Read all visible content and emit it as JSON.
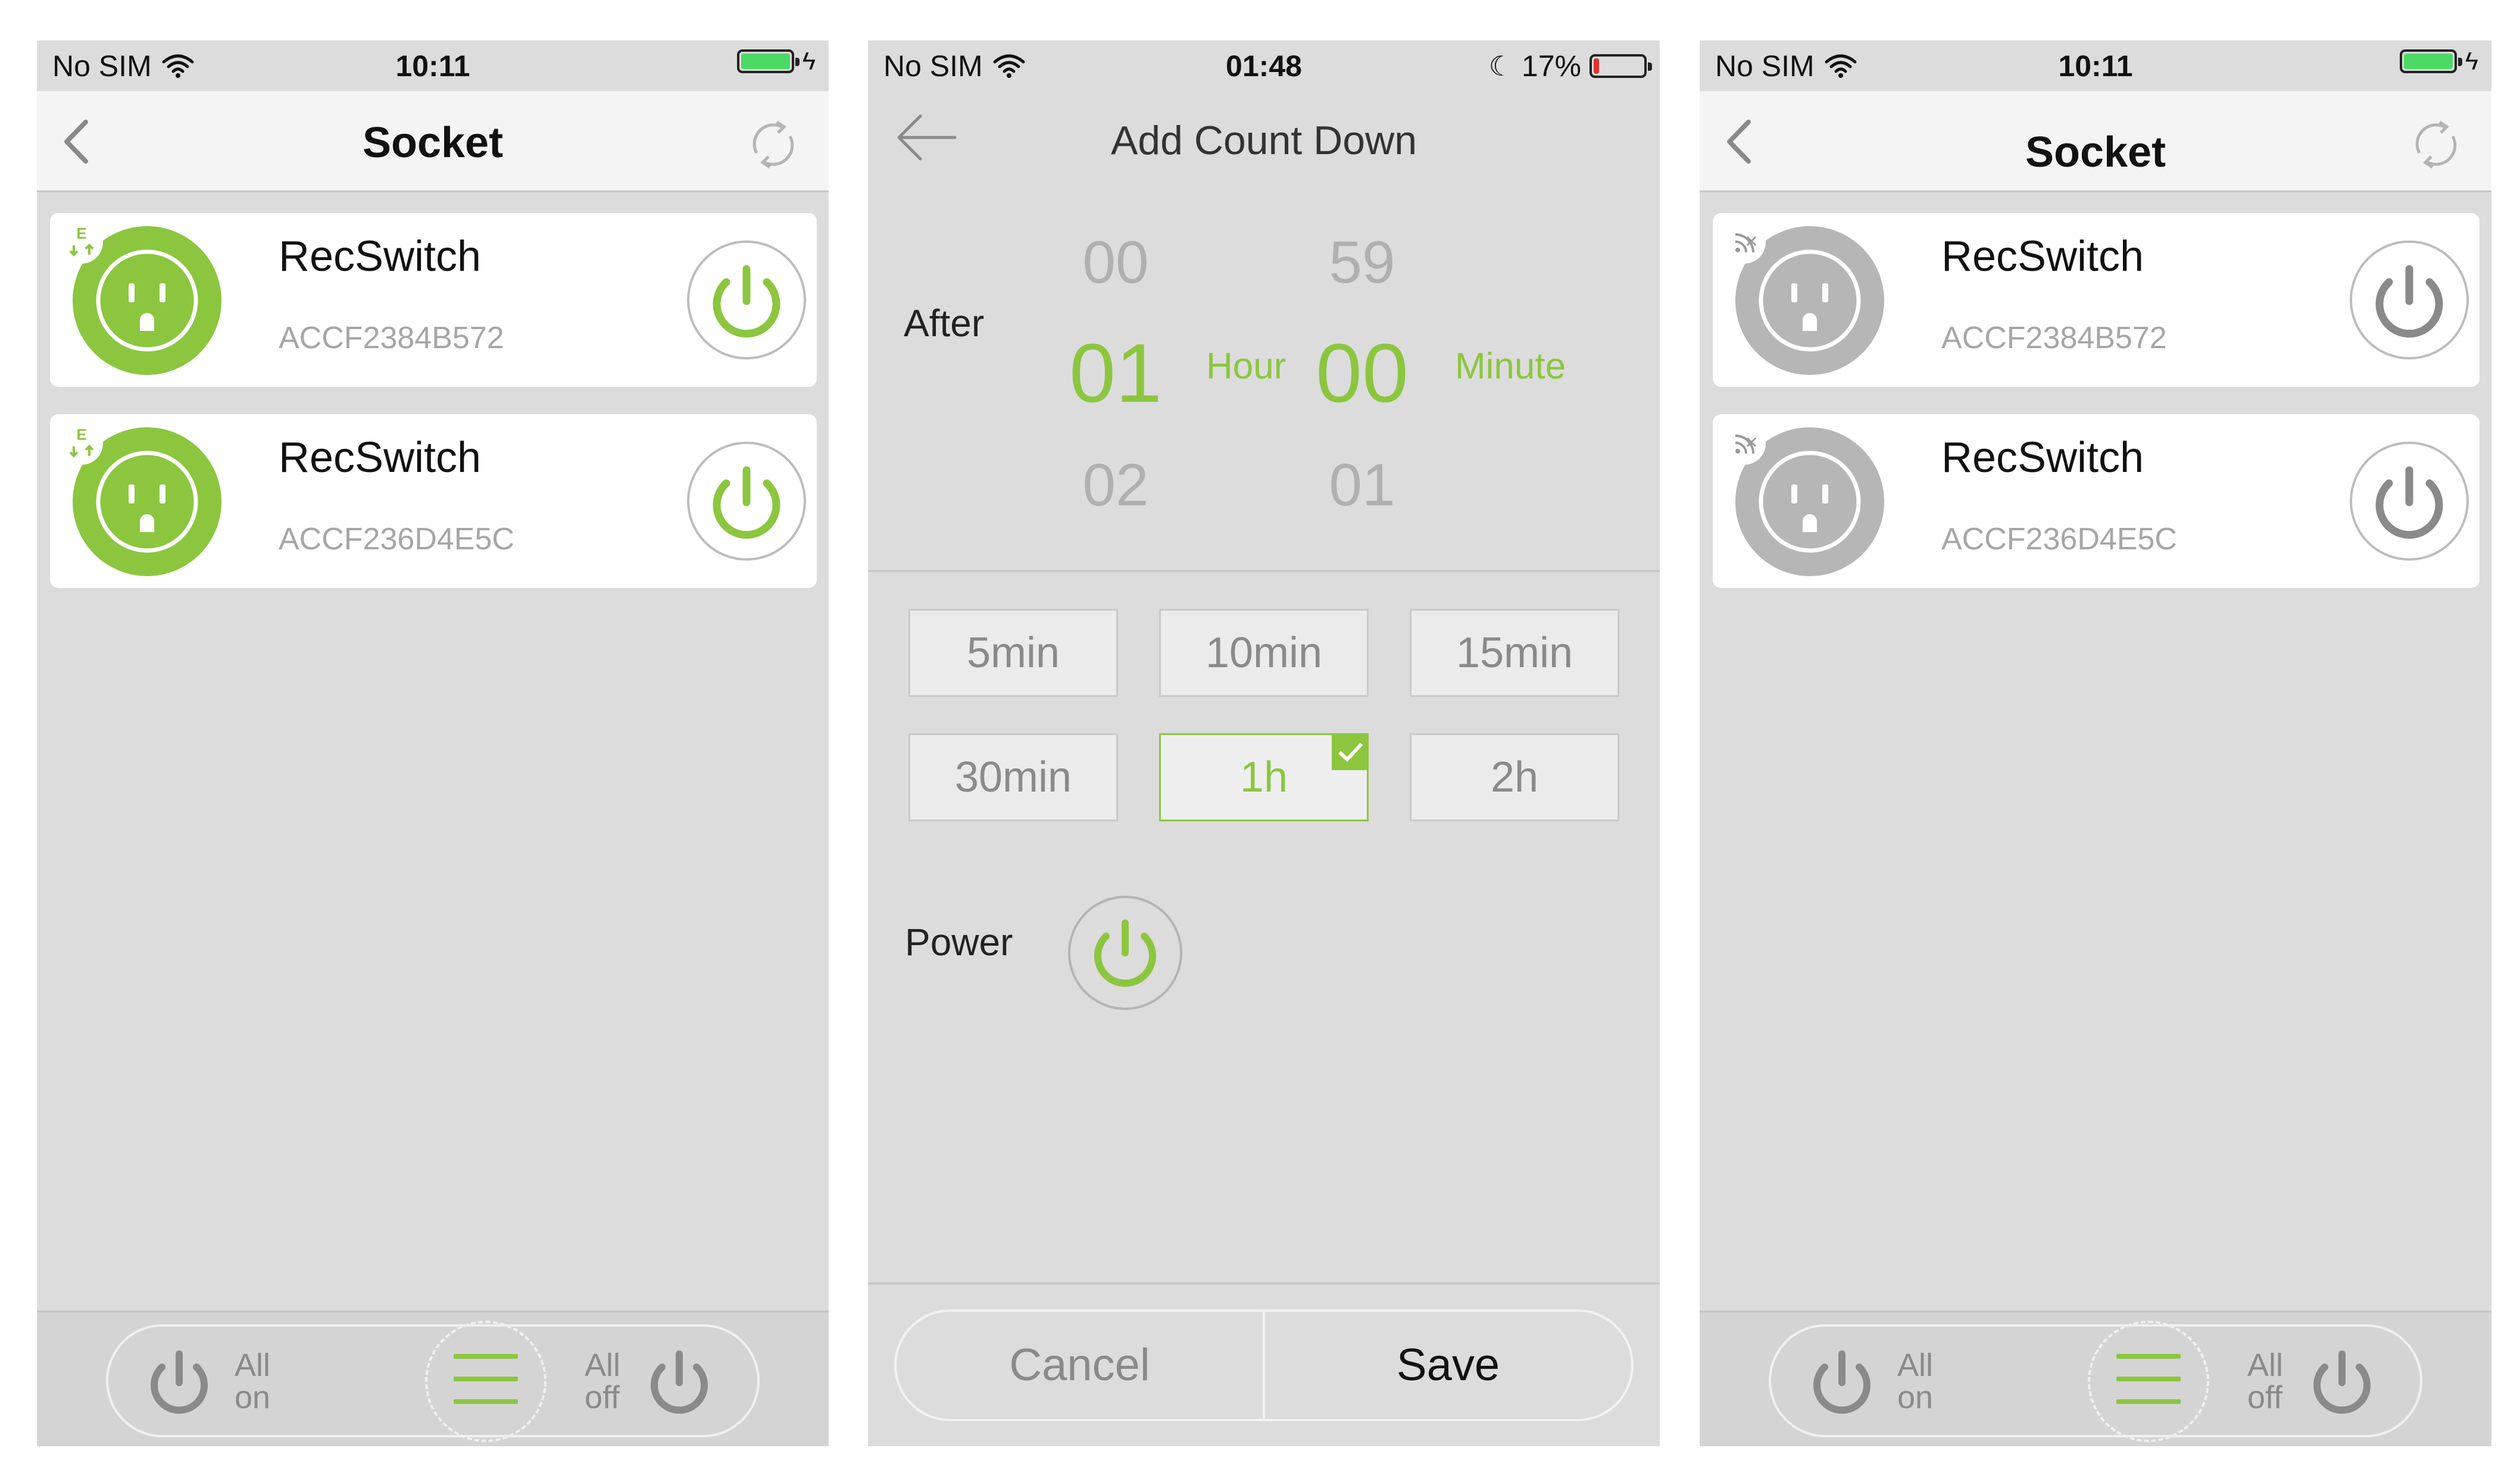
{
  "colors": {
    "accent": "#8cc63f",
    "offline": "#b6b6b6",
    "battery_low": "#e0312e"
  },
  "screen1": {
    "status": {
      "carrier": "No SIM",
      "time": "10:11",
      "battery_level": 1.0
    },
    "nav": {
      "title": "Socket"
    },
    "devices": [
      {
        "name": "RecSwitch",
        "mac": "ACCF2384B572",
        "online": true,
        "badge_icon": "energy-badge-icon"
      },
      {
        "name": "RecSwitch",
        "mac": "ACCF236D4E5C",
        "online": true,
        "badge_icon": "energy-badge-icon"
      }
    ],
    "bottom": {
      "all_on": [
        "All",
        "on"
      ],
      "all_off": [
        "All",
        "off"
      ]
    }
  },
  "screen2": {
    "status": {
      "carrier": "No SIM",
      "time": "01:48",
      "battery_pct": "17%",
      "battery_level": 0.17
    },
    "nav": {
      "title": "Add Count Down"
    },
    "picker": {
      "after_label": "After",
      "hour_above": "00",
      "hour_selected": "01",
      "hour_below": "02",
      "hour_unit": "Hour",
      "minute_above": "59",
      "minute_selected": "00",
      "minute_below": "01",
      "minute_unit": "Minute"
    },
    "presets": [
      "5min",
      "10min",
      "15min",
      "30min",
      "1h",
      "2h"
    ],
    "selected_preset": "1h",
    "power_label": "Power",
    "cancel_label": "Cancel",
    "save_label": "Save"
  },
  "screen3": {
    "status": {
      "carrier": "No SIM",
      "time": "10:11",
      "battery_level": 1.0
    },
    "nav": {
      "title": "Socket"
    },
    "devices": [
      {
        "name": "RecSwitch",
        "mac": "ACCF2384B572",
        "online": false,
        "badge_icon": "offline-badge-icon"
      },
      {
        "name": "RecSwitch",
        "mac": "ACCF236D4E5C",
        "online": false,
        "badge_icon": "offline-badge-icon"
      }
    ],
    "bottom": {
      "all_on": [
        "All",
        "on"
      ],
      "all_off": [
        "All",
        "off"
      ]
    }
  }
}
